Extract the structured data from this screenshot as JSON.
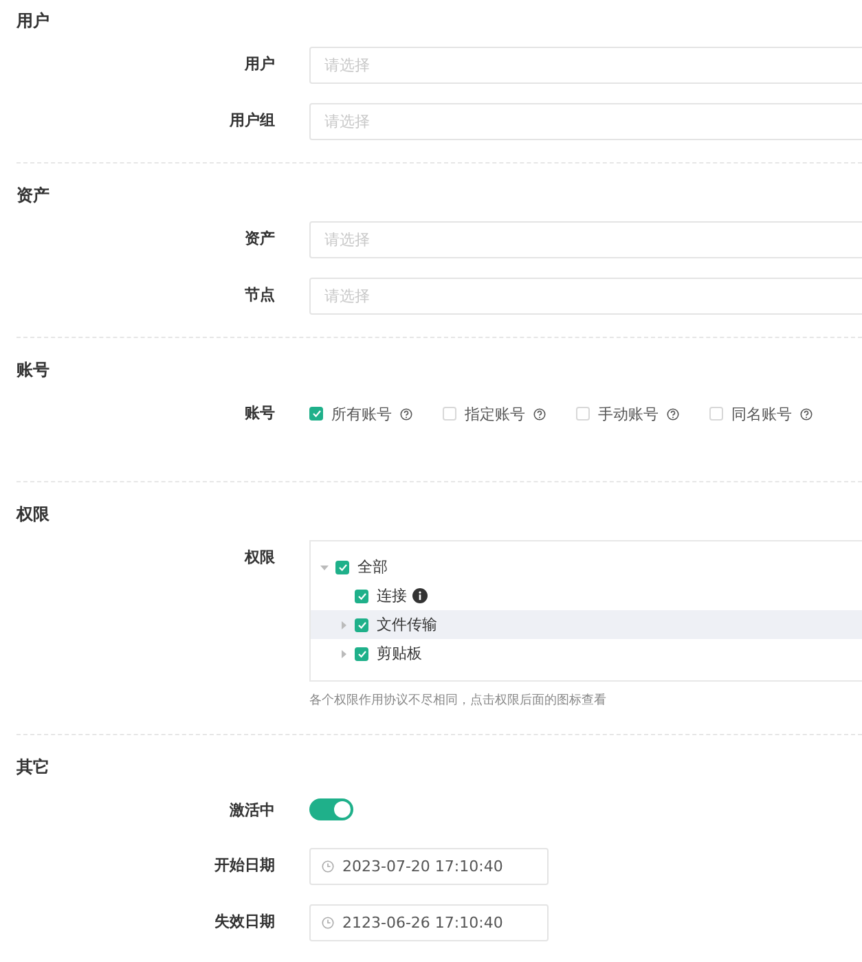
{
  "sections": [
    {
      "title": "用户",
      "fields": [
        {
          "kind": "select",
          "label": "用户",
          "placeholder": "请选择"
        },
        {
          "kind": "select",
          "label": "用户组",
          "placeholder": "请选择"
        }
      ]
    },
    {
      "title": "资产",
      "fields": [
        {
          "kind": "select",
          "label": "资产",
          "placeholder": "请选择"
        },
        {
          "kind": "select",
          "label": "节点",
          "placeholder": "请选择"
        }
      ]
    },
    {
      "title": "账号",
      "fields": [
        {
          "kind": "checkboxes",
          "label": "账号",
          "options": [
            {
              "label": "所有账号",
              "checked": true,
              "help": true
            },
            {
              "label": "指定账号",
              "checked": false,
              "help": true
            },
            {
              "label": "手动账号",
              "checked": false,
              "help": true
            },
            {
              "label": "同名账号",
              "checked": false,
              "help": true
            }
          ]
        }
      ]
    },
    {
      "title": "权限",
      "fields": [
        {
          "kind": "tree",
          "label": "权限",
          "hint": "各个权限作用协议不尽相同，点击权限后面的图标查看",
          "nodes": [
            {
              "label": "全部",
              "checked": true,
              "expanded": true,
              "highlighted": false,
              "children": [
                {
                  "label": "连接",
                  "checked": true,
                  "info": true,
                  "highlighted": false
                },
                {
                  "label": "文件传输",
                  "checked": true,
                  "expanded": false,
                  "highlighted": true
                },
                {
                  "label": "剪贴板",
                  "checked": true,
                  "expanded": false,
                  "highlighted": false
                }
              ]
            }
          ]
        }
      ]
    },
    {
      "title": "其它",
      "fields": [
        {
          "kind": "switch",
          "label": "激活中",
          "on": true
        },
        {
          "kind": "datetime",
          "label": "开始日期",
          "value": "2023-07-20 17:10:40"
        },
        {
          "kind": "datetime",
          "label": "失效日期",
          "value": "2123-06-26 17:10:40"
        }
      ]
    }
  ]
}
